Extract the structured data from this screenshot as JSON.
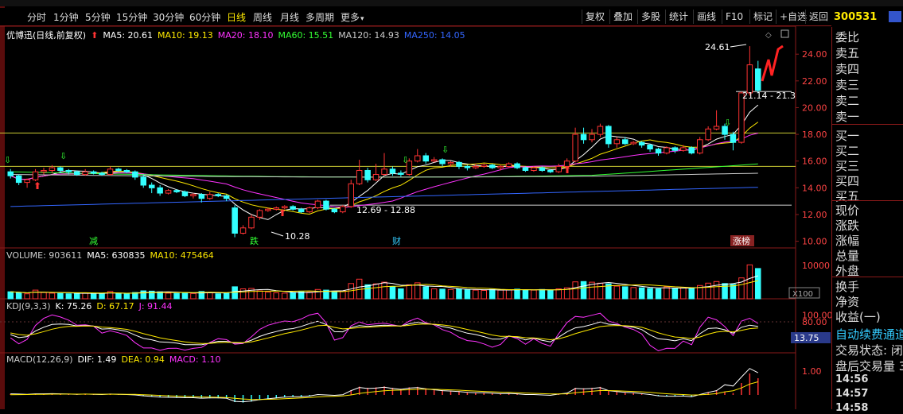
{
  "toolbar": {
    "periods": [
      "分时",
      "1分钟",
      "5分钟",
      "15分钟",
      "30分钟",
      "60分钟",
      "日线",
      "周线",
      "月线",
      "多周期",
      "更多"
    ],
    "active_period": "日线",
    "right_buttons": [
      "复权",
      "叠加",
      "多股",
      "统计",
      "画线",
      "F10",
      "标记",
      "+自选",
      "返回"
    ]
  },
  "stock": {
    "code": "300531"
  },
  "price_legend": {
    "name": "优博迅(日线,前复权)",
    "items": [
      {
        "label": "MA5: 20.61",
        "color": "#ffffff"
      },
      {
        "label": "MA10: 19.13",
        "color": "#ffea00"
      },
      {
        "label": "MA20: 18.10",
        "color": "#ff33ff"
      },
      {
        "label": "MA60: 15.51",
        "color": "#33ff33"
      },
      {
        "label": "MA120: 14.93",
        "color": "#cccccc"
      },
      {
        "label": "MA250: 14.05",
        "color": "#3366ff"
      }
    ]
  },
  "volume_legend": {
    "items": [
      {
        "label": "VOLUME: 903611",
        "color": "#cccccc"
      },
      {
        "label": "MA5: 630835",
        "color": "#ffffff"
      },
      {
        "label": "MA10: 475464",
        "color": "#ffea00"
      }
    ]
  },
  "kdj_legend": {
    "items": [
      {
        "label": "KDJ(9,3,3)",
        "color": "#cccccc"
      },
      {
        "label": "K: 75.26",
        "color": "#ffffff"
      },
      {
        "label": "D: 67.17",
        "color": "#ffea00"
      },
      {
        "label": "J: 91.44",
        "color": "#ff33ff"
      }
    ]
  },
  "macd_legend": {
    "items": [
      {
        "label": "MACD(12,26,9)",
        "color": "#cccccc"
      },
      {
        "label": "DIF: 1.49",
        "color": "#ffffff"
      },
      {
        "label": "DEA: 0.94",
        "color": "#ffea00"
      },
      {
        "label": "MACD: 1.10",
        "color": "#ff33ff"
      }
    ]
  },
  "annotations": {
    "high": "24.61",
    "current_range": "21.14 - 21.3",
    "low_range": "12.69 - 12.88",
    "low": "10.28",
    "markers": [
      "减",
      "跌",
      "财",
      "涨榜"
    ]
  },
  "axis": {
    "price_ticks": [
      "24.00",
      "22.00",
      "20.00",
      "18.00",
      "16.00",
      "14.00",
      "12.00",
      "10.00"
    ],
    "volume_ticks": [
      "10000"
    ],
    "volume_unit": "X100",
    "kdj_ticks": [
      "100.00",
      "80.00"
    ],
    "kdj_value": "13.75",
    "macd_ticks": [
      "1.00"
    ]
  },
  "side_panel": {
    "sell": [
      "委比",
      "卖五",
      "卖四",
      "卖三",
      "卖二",
      "卖一"
    ],
    "buy": [
      "买一",
      "买二",
      "买三",
      "买四",
      "买五"
    ],
    "stats": [
      "现价",
      "涨跌",
      "涨幅",
      "总量",
      "外盘"
    ],
    "stats2": [
      "换手",
      "净资",
      "收益(一)"
    ],
    "notice": "自动续费通道",
    "trade_status": "交易状态: 闭",
    "after_hours": "盘后交易量 3",
    "times": [
      "14:56",
      "14:57",
      "14:58"
    ]
  },
  "colors": {
    "up": "#ff3333",
    "down": "#33ffff",
    "grid": "#8a1a1a",
    "bg": "#000000"
  },
  "chart_data": {
    "type": "candlestick",
    "title": "优博迅(日线,前复权)",
    "ylim": [
      9.5,
      25.2
    ],
    "candles": [
      {
        "o": 15.2,
        "c": 14.9,
        "h": 15.4,
        "l": 14.7
      },
      {
        "o": 14.9,
        "c": 14.4,
        "h": 15.0,
        "l": 14.2
      },
      {
        "o": 14.4,
        "c": 14.6,
        "h": 14.7,
        "l": 14.0
      },
      {
        "o": 14.6,
        "c": 15.2,
        "h": 15.4,
        "l": 14.5
      },
      {
        "o": 15.2,
        "c": 15.3,
        "h": 15.5,
        "l": 15.0
      },
      {
        "o": 15.3,
        "c": 15.5,
        "h": 15.7,
        "l": 15.1
      },
      {
        "o": 15.5,
        "c": 15.3,
        "h": 15.6,
        "l": 15.1
      },
      {
        "o": 15.3,
        "c": 15.2,
        "h": 15.4,
        "l": 15.0
      },
      {
        "o": 15.2,
        "c": 15.0,
        "h": 15.3,
        "l": 14.9
      },
      {
        "o": 15.0,
        "c": 15.2,
        "h": 15.4,
        "l": 14.9
      },
      {
        "o": 15.2,
        "c": 15.1,
        "h": 15.3,
        "l": 15.0
      },
      {
        "o": 15.1,
        "c": 15.0,
        "h": 15.2,
        "l": 14.9
      },
      {
        "o": 15.0,
        "c": 15.4,
        "h": 15.6,
        "l": 14.9
      },
      {
        "o": 15.4,
        "c": 15.3,
        "h": 15.5,
        "l": 15.2
      },
      {
        "o": 15.3,
        "c": 15.2,
        "h": 15.4,
        "l": 15.1
      },
      {
        "o": 15.2,
        "c": 14.8,
        "h": 15.3,
        "l": 14.6
      },
      {
        "o": 14.8,
        "c": 14.2,
        "h": 15.0,
        "l": 14.0
      },
      {
        "o": 14.2,
        "c": 14.0,
        "h": 14.4,
        "l": 13.6
      },
      {
        "o": 14.0,
        "c": 13.6,
        "h": 14.2,
        "l": 13.4
      },
      {
        "o": 13.6,
        "c": 13.8,
        "h": 13.9,
        "l": 13.5
      },
      {
        "o": 13.8,
        "c": 13.7,
        "h": 13.9,
        "l": 13.6
      },
      {
        "o": 13.7,
        "c": 13.4,
        "h": 13.8,
        "l": 13.3
      },
      {
        "o": 13.4,
        "c": 13.5,
        "h": 13.6,
        "l": 13.2
      },
      {
        "o": 13.5,
        "c": 13.2,
        "h": 13.6,
        "l": 12.9
      },
      {
        "o": 13.2,
        "c": 13.5,
        "h": 13.7,
        "l": 13.1
      },
      {
        "o": 13.5,
        "c": 13.4,
        "h": 13.6,
        "l": 13.3
      },
      {
        "o": 13.4,
        "c": 13.2,
        "h": 13.5,
        "l": 13.0
      },
      {
        "o": 12.5,
        "c": 10.6,
        "h": 12.7,
        "l": 10.3
      },
      {
        "o": 10.6,
        "c": 11.0,
        "h": 11.2,
        "l": 10.5
      },
      {
        "o": 11.0,
        "c": 11.8,
        "h": 12.0,
        "l": 10.9
      },
      {
        "o": 11.8,
        "c": 12.3,
        "h": 12.4,
        "l": 11.6
      },
      {
        "o": 12.3,
        "c": 12.4,
        "h": 12.5,
        "l": 12.2
      },
      {
        "o": 12.4,
        "c": 12.5,
        "h": 12.6,
        "l": 12.3
      },
      {
        "o": 12.5,
        "c": 12.6,
        "h": 12.7,
        "l": 12.4
      },
      {
        "o": 12.6,
        "c": 12.4,
        "h": 12.7,
        "l": 12.3
      },
      {
        "o": 12.4,
        "c": 12.2,
        "h": 12.5,
        "l": 12.1
      },
      {
        "o": 12.2,
        "c": 12.5,
        "h": 12.6,
        "l": 12.1
      },
      {
        "o": 12.5,
        "c": 13.0,
        "h": 13.1,
        "l": 12.4
      },
      {
        "o": 13.0,
        "c": 12.4,
        "h": 13.1,
        "l": 12.3
      },
      {
        "o": 12.4,
        "c": 12.2,
        "h": 12.5,
        "l": 12.1
      },
      {
        "o": 12.2,
        "c": 12.6,
        "h": 12.7,
        "l": 12.1
      },
      {
        "o": 12.6,
        "c": 14.3,
        "h": 14.6,
        "l": 12.5
      },
      {
        "o": 14.3,
        "c": 15.3,
        "h": 16.1,
        "l": 14.2
      },
      {
        "o": 15.3,
        "c": 14.6,
        "h": 15.5,
        "l": 14.4
      },
      {
        "o": 14.6,
        "c": 15.0,
        "h": 15.8,
        "l": 14.5
      },
      {
        "o": 15.0,
        "c": 15.4,
        "h": 16.6,
        "l": 14.9
      },
      {
        "o": 15.4,
        "c": 15.1,
        "h": 15.6,
        "l": 14.9
      },
      {
        "o": 15.1,
        "c": 15.0,
        "h": 15.3,
        "l": 14.8
      },
      {
        "o": 15.0,
        "c": 16.0,
        "h": 16.2,
        "l": 14.9
      },
      {
        "o": 16.0,
        "c": 16.4,
        "h": 16.9,
        "l": 15.9
      },
      {
        "o": 16.4,
        "c": 16.0,
        "h": 16.6,
        "l": 15.8
      },
      {
        "o": 16.0,
        "c": 16.1,
        "h": 16.3,
        "l": 15.9
      },
      {
        "o": 16.1,
        "c": 15.8,
        "h": 16.2,
        "l": 15.6
      },
      {
        "o": 15.8,
        "c": 15.9,
        "h": 16.0,
        "l": 15.6
      },
      {
        "o": 15.9,
        "c": 15.6,
        "h": 16.0,
        "l": 15.4
      },
      {
        "o": 15.6,
        "c": 15.5,
        "h": 15.7,
        "l": 15.3
      },
      {
        "o": 15.5,
        "c": 15.6,
        "h": 15.8,
        "l": 15.4
      },
      {
        "o": 15.6,
        "c": 15.7,
        "h": 15.8,
        "l": 15.5
      },
      {
        "o": 15.7,
        "c": 15.5,
        "h": 15.8,
        "l": 15.4
      },
      {
        "o": 15.5,
        "c": 15.6,
        "h": 15.7,
        "l": 15.3
      },
      {
        "o": 15.6,
        "c": 15.8,
        "h": 15.9,
        "l": 15.5
      },
      {
        "o": 15.8,
        "c": 15.5,
        "h": 15.9,
        "l": 15.4
      },
      {
        "o": 15.5,
        "c": 15.3,
        "h": 15.6,
        "l": 15.2
      },
      {
        "o": 15.3,
        "c": 15.5,
        "h": 15.6,
        "l": 15.2
      },
      {
        "o": 15.5,
        "c": 15.3,
        "h": 15.6,
        "l": 15.2
      },
      {
        "o": 15.3,
        "c": 15.2,
        "h": 15.4,
        "l": 15.1
      },
      {
        "o": 15.2,
        "c": 15.6,
        "h": 15.8,
        "l": 15.1
      },
      {
        "o": 15.6,
        "c": 16.0,
        "h": 16.2,
        "l": 15.5
      },
      {
        "o": 16.0,
        "c": 18.0,
        "h": 18.5,
        "l": 15.9
      },
      {
        "o": 18.0,
        "c": 17.6,
        "h": 18.5,
        "l": 17.3
      },
      {
        "o": 17.6,
        "c": 18.0,
        "h": 18.4,
        "l": 17.4
      },
      {
        "o": 18.0,
        "c": 18.6,
        "h": 18.8,
        "l": 17.8
      },
      {
        "o": 18.6,
        "c": 17.3,
        "h": 18.7,
        "l": 17.0
      },
      {
        "o": 17.3,
        "c": 17.6,
        "h": 17.8,
        "l": 17.0
      },
      {
        "o": 17.6,
        "c": 17.3,
        "h": 17.8,
        "l": 17.2
      },
      {
        "o": 17.3,
        "c": 17.4,
        "h": 17.5,
        "l": 17.2
      },
      {
        "o": 17.4,
        "c": 17.2,
        "h": 17.5,
        "l": 17.0
      },
      {
        "o": 17.2,
        "c": 16.9,
        "h": 17.3,
        "l": 16.7
      },
      {
        "o": 16.9,
        "c": 16.6,
        "h": 17.0,
        "l": 16.4
      },
      {
        "o": 16.6,
        "c": 17.0,
        "h": 17.1,
        "l": 16.5
      },
      {
        "o": 17.0,
        "c": 16.8,
        "h": 17.1,
        "l": 16.6
      },
      {
        "o": 16.8,
        "c": 17.0,
        "h": 17.2,
        "l": 16.7
      },
      {
        "o": 17.0,
        "c": 16.6,
        "h": 17.1,
        "l": 16.5
      },
      {
        "o": 16.6,
        "c": 17.6,
        "h": 17.8,
        "l": 16.5
      },
      {
        "o": 17.6,
        "c": 18.4,
        "h": 18.6,
        "l": 17.5
      },
      {
        "o": 18.4,
        "c": 18.6,
        "h": 19.8,
        "l": 18.3
      },
      {
        "o": 18.6,
        "c": 18.0,
        "h": 18.8,
        "l": 17.6
      },
      {
        "o": 18.0,
        "c": 17.4,
        "h": 18.2,
        "l": 16.8
      },
      {
        "o": 17.4,
        "c": 21.1,
        "h": 21.2,
        "l": 17.3
      },
      {
        "o": 21.1,
        "c": 23.2,
        "h": 24.6,
        "l": 20.9
      },
      {
        "o": 22.9,
        "c": 21.3,
        "h": 23.5,
        "l": 21.1
      }
    ],
    "volume": [
      2100,
      1800,
      1500,
      2600,
      1900,
      1700,
      1600,
      1500,
      1700,
      1800,
      1600,
      1500,
      2200,
      1600,
      1500,
      1900,
      2400,
      2300,
      2100,
      1700,
      1600,
      1800,
      1600,
      2200,
      1900,
      1500,
      1700,
      3600,
      3000,
      3100,
      2400,
      2000,
      1800,
      1700,
      1900,
      2100,
      2000,
      2800,
      2600,
      2300,
      2400,
      4600,
      5900,
      4200,
      4500,
      5000,
      3600,
      3000,
      4200,
      4800,
      3600,
      3000,
      2900,
      2800,
      3000,
      2700,
      2600,
      2500,
      2800,
      2600,
      2700,
      2900,
      2700,
      2600,
      2800,
      2500,
      3000,
      3300,
      5100,
      5200,
      5000,
      4700,
      4500,
      3800,
      3600,
      3400,
      3300,
      3100,
      3000,
      3600,
      3200,
      3300,
      3100,
      4000,
      4700,
      5200,
      4600,
      4300,
      6300,
      10200,
      9100
    ],
    "volume_ylim": [
      0,
      11000
    ],
    "macd_hist": [
      0.05,
      0.04,
      0.03,
      0.05,
      0.05,
      0.06,
      0.05,
      0.04,
      0.03,
      0.04,
      0.03,
      0.02,
      0.04,
      0.03,
      0.02,
      0.0,
      -0.04,
      -0.07,
      -0.1,
      -0.11,
      -0.12,
      -0.13,
      -0.13,
      -0.15,
      -0.14,
      -0.14,
      -0.15,
      -0.3,
      -0.32,
      -0.28,
      -0.22,
      -0.18,
      -0.14,
      -0.1,
      -0.08,
      -0.08,
      -0.05,
      0.02,
      0.0,
      -0.02,
      0.01,
      0.2,
      0.35,
      0.3,
      0.32,
      0.36,
      0.3,
      0.26,
      0.32,
      0.34,
      0.28,
      0.24,
      0.2,
      0.18,
      0.16,
      0.12,
      0.1,
      0.1,
      0.08,
      0.06,
      0.07,
      0.05,
      0.02,
      0.02,
      0.0,
      -0.02,
      0.04,
      0.08,
      0.3,
      0.28,
      0.3,
      0.34,
      0.2,
      0.16,
      0.12,
      0.1,
      0.06,
      0.02,
      -0.04,
      -0.06,
      -0.06,
      -0.05,
      -0.08,
      0.02,
      0.12,
      0.2,
      0.14,
      0.08,
      0.5,
      0.9,
      0.7
    ],
    "macd_ylim": [
      -0.5,
      1.3
    ]
  }
}
